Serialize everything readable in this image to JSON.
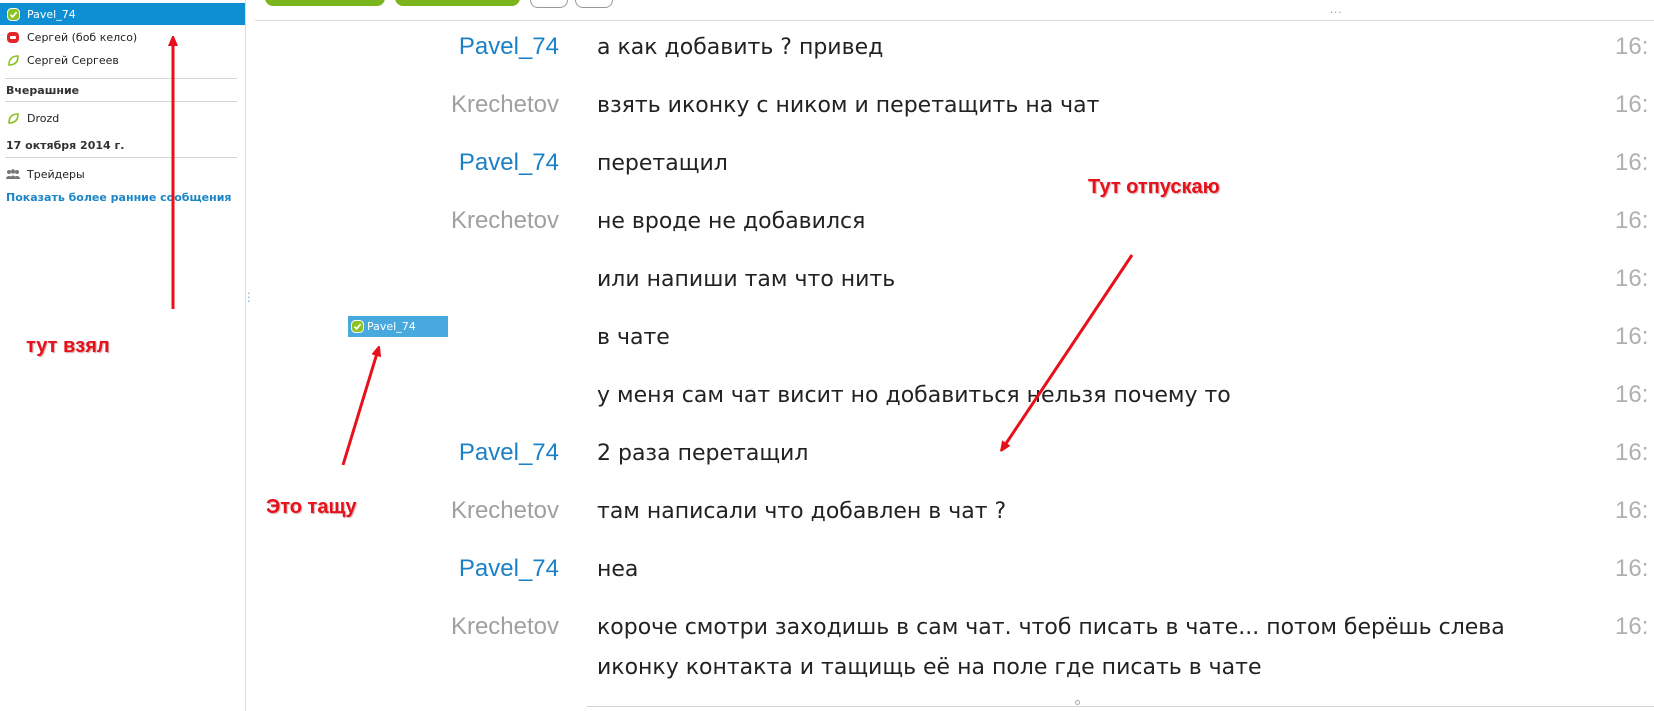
{
  "sidebar": {
    "contacts": [
      {
        "name": "Pavel_74",
        "status_icon": "online-check-icon",
        "selected": true
      },
      {
        "name": "Сергей (боб келсо)",
        "status_icon": "phone-icon",
        "selected": false
      },
      {
        "name": "Сергей Сергеев",
        "status_icon": "offline-leaf-icon",
        "selected": false
      }
    ],
    "yesterday_label": "Вчерашние",
    "yesterday_contacts": [
      {
        "name": "Drozd",
        "status_icon": "offline-leaf-icon"
      }
    ],
    "date_label": "17 октября 2014 г.",
    "date_contacts": [
      {
        "name": "Трейдеры",
        "status_icon": "group-icon"
      }
    ],
    "show_earlier": "Показать более ранние сообщения"
  },
  "chat": {
    "messages": [
      {
        "author": "Pavel_74",
        "text": "а как добавить ? привед",
        "time": "16:"
      },
      {
        "author": "Krechetov",
        "text": "взять иконку с ником и перетащить на чат",
        "time": "16:"
      },
      {
        "author": "Pavel_74",
        "text": "перетащил",
        "time": "16:"
      },
      {
        "author": "Krechetov",
        "text": "не вроде не добавился",
        "time": "16:"
      },
      {
        "author": "",
        "text": "или напиши там что нить",
        "time": "16:"
      },
      {
        "author": "",
        "text": "в чате",
        "time": "16:"
      },
      {
        "author": "",
        "text": "у меня сам чат висит но добавиться нельзя почему то",
        "time": "16:"
      },
      {
        "author": "Pavel_74",
        "text": "2 раза перетащил",
        "time": "16:"
      },
      {
        "author": "Krechetov",
        "text": "там написали что добавлен в чат ?",
        "time": "16:"
      },
      {
        "author": "Pavel_74",
        "text": "неа",
        "time": "16:"
      },
      {
        "author": "Krechetov",
        "text": "короче смотри заходишь в сам чат. чтоб писать в чате... потом берёшь слева",
        "text2": "иконку контакта и тащищь её на поле где писать в чате",
        "time": "16:"
      }
    ]
  },
  "drag_ghost": {
    "name": "Pavel_74"
  },
  "annotations": {
    "took_here": "тут взял",
    "dragging": "Это тащу",
    "release_here": "Тут отпускаю"
  },
  "colors": {
    "selected_bg": "#0f8fd3",
    "pavel_author": "#1b80c5",
    "krechetov_author": "#a0a0a0",
    "annotation_red": "#e8101a",
    "green_button": "#7ab51d"
  }
}
